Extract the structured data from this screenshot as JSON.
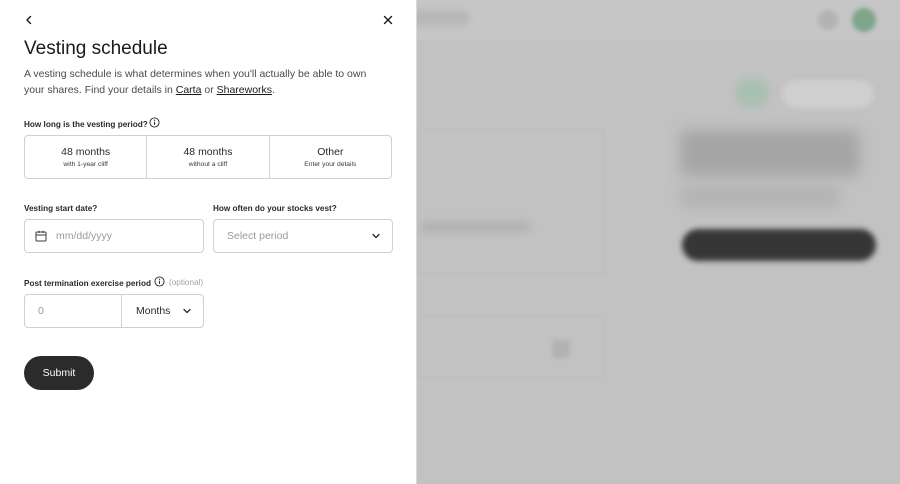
{
  "panel": {
    "title": "Vesting schedule",
    "description_pre": "A vesting schedule is what determines when you'll actually be able to own your shares. Find your details in ",
    "link_carta": "Carta",
    "description_or": " or ",
    "link_shareworks": "Shareworks",
    "description_end": "."
  },
  "vesting_period": {
    "label": "How long is the vesting period?",
    "options": [
      {
        "main": "48 months",
        "sub": "with 1-year cliff"
      },
      {
        "main": "48 months",
        "sub": "without a cliff"
      },
      {
        "main": "Other",
        "sub": "Enter your details"
      }
    ]
  },
  "start_date": {
    "label": "Vesting start date?",
    "placeholder": "mm/dd/yyyy"
  },
  "frequency": {
    "label": "How often do your stocks vest?",
    "placeholder": "Select period"
  },
  "post_termination": {
    "label": "Post termination exercise period",
    "optional": "(optional)",
    "value_placeholder": "0",
    "unit": "Months"
  },
  "submit_label": "Submit",
  "icons": {
    "back": "chevron-left-icon",
    "close": "close-icon",
    "info": "info-icon",
    "calendar": "calendar-icon",
    "dropdown": "chevron-down-icon"
  },
  "colors": {
    "primary_button": "#2b2b2b",
    "overlay": "#c2c2c2",
    "border": "#d0d0d0"
  }
}
